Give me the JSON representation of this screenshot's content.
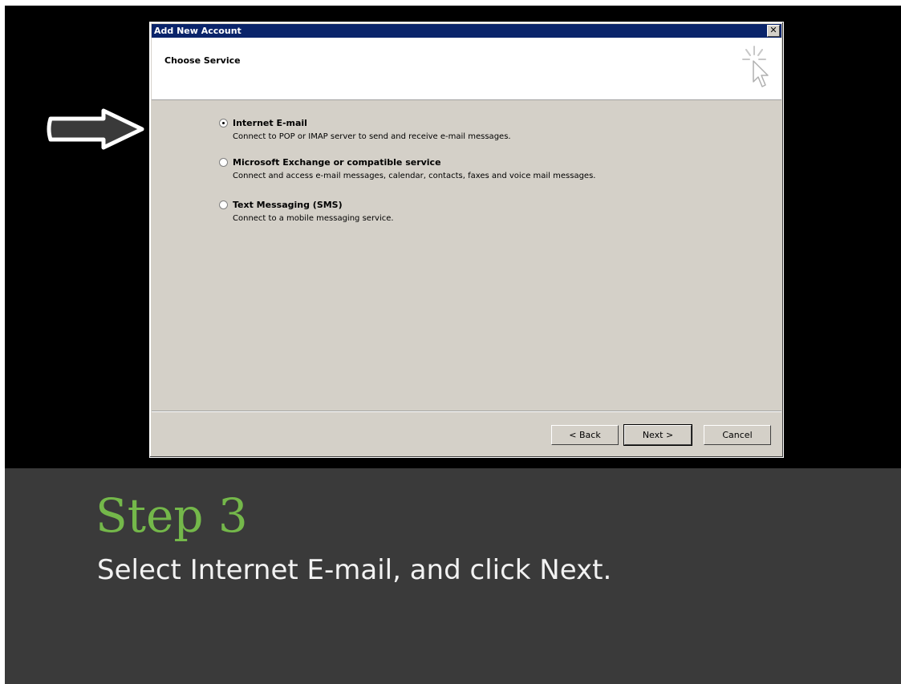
{
  "dialog": {
    "title": "Add New Account",
    "close_glyph": "✕",
    "heading": "Choose Service",
    "options": [
      {
        "label": "Internet E-mail",
        "description": "Connect to POP or IMAP server to send and receive e-mail messages.",
        "selected": true
      },
      {
        "label": "Microsoft Exchange or compatible service",
        "description": "Connect and access e-mail messages, calendar, contacts, faxes and voice mail messages.",
        "selected": false
      },
      {
        "label": "Text Messaging (SMS)",
        "description": "Connect to a mobile messaging service.",
        "selected": false
      }
    ],
    "buttons": {
      "back": "< Back",
      "next": "Next >",
      "cancel": "Cancel"
    }
  },
  "caption": {
    "step": "Step 3",
    "instruction": "Select Internet E-mail, and click Next."
  },
  "icons": {
    "pointer": "right-arrow-icon",
    "wizard": "cursor-click-icon"
  },
  "colors": {
    "titlebar": "#0a246a",
    "dialog_bg": "#d4d0c8",
    "step_text": "#74b84a",
    "caption_bg": "#3a3a3a"
  }
}
